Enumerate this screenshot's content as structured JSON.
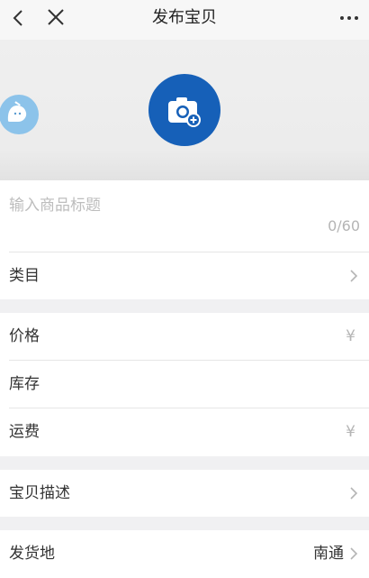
{
  "header": {
    "title": "发布宝贝",
    "icons": {
      "back": "chevron-left-icon",
      "close": "close-icon",
      "more": "more-dots-icon"
    }
  },
  "photo_area": {
    "mascot_icon": "mascot-icon",
    "add_photo_icon": "camera-plus-icon"
  },
  "product_title": {
    "placeholder": "输入商品标题",
    "value": "",
    "count": "0/60"
  },
  "category": {
    "label": "类目"
  },
  "price": {
    "label": "价格",
    "currency": "¥"
  },
  "stock": {
    "label": "库存"
  },
  "shipping_fee": {
    "label": "运费",
    "currency": "¥"
  },
  "description": {
    "label": "宝贝描述"
  },
  "ship_from": {
    "label": "发货地",
    "value": "南通"
  },
  "colors": {
    "accent": "#1660b8",
    "mascot": "#8cc3ea"
  }
}
